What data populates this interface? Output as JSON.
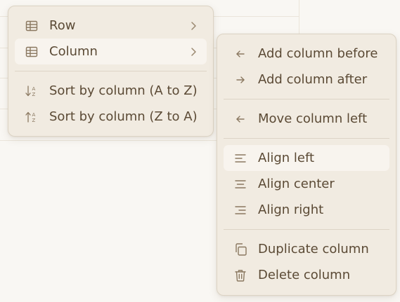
{
  "primary_menu": {
    "items": [
      {
        "label": "Row",
        "icon": "table-icon"
      },
      {
        "label": "Column",
        "icon": "table-icon"
      }
    ],
    "sort_items": [
      {
        "label": "Sort by column (A to Z)",
        "icon": "sort-ascending-icon"
      },
      {
        "label": "Sort by column (Z to A)",
        "icon": "sort-descending-icon"
      }
    ]
  },
  "column_submenu": {
    "add_before": "Add column before",
    "add_after": "Add column after",
    "move_left": "Move column left",
    "align_left": "Align left",
    "align_center": "Align center",
    "align_right": "Align right",
    "duplicate": "Duplicate column",
    "delete": "Delete column"
  },
  "colors": {
    "menu_bg": "#f1ebe1",
    "highlight_bg": "#f8f4ee",
    "text": "#5b4a35",
    "icon": "#8a7860",
    "border": "#dcd3c4",
    "page_bg": "#f9f7f3"
  }
}
